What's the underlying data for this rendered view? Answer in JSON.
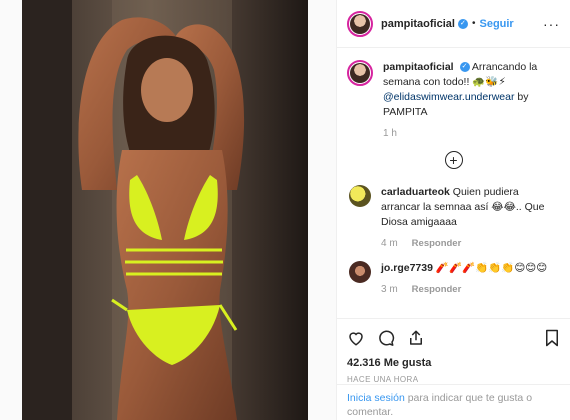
{
  "post": {
    "username": "pampitaoficial",
    "follow_label": "Seguir",
    "dot": "•",
    "more_label": "···"
  },
  "caption": {
    "username": "pampitaoficial",
    "text": "Arrancando la semana con todo!! 🐢🐝⚡",
    "mention": "@elidaswimwear.underwear",
    "suffix": " by PAMPITA",
    "time": "1 h"
  },
  "comments": [
    {
      "username": "carladuarteok",
      "text": "Quien pudiera arrancar la semnaa así 😂😂.. Que Diosa amigaaaa",
      "time": "4 m",
      "reply_label": "Responder"
    },
    {
      "username": "jo.rge7739",
      "text": "🧨🧨🧨👏👏👏😊😊😊",
      "time": "3 m",
      "reply_label": "Responder"
    }
  ],
  "actions": {
    "likes": "42.316 Me gusta",
    "timestamp": "HACE UNA HORA"
  },
  "login": {
    "link_label": "Inicia sesión",
    "text": " para indicar que te gusta o comentar."
  },
  "icons": {
    "like": "heart-icon",
    "comment": "comment-icon",
    "share": "share-icon",
    "save": "bookmark-icon",
    "add_comments": "plus-circle-icon"
  },
  "colors": {
    "link": "#3897f0",
    "verified": "#3897f0",
    "ring": "#d6249f",
    "swimwear": "#d8f020"
  }
}
